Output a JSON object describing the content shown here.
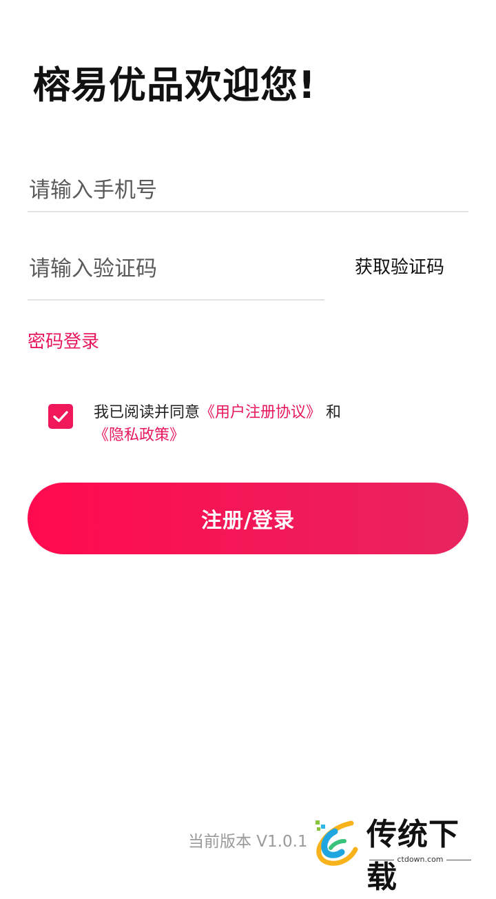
{
  "header": {
    "title": "榕易优品欢迎您!"
  },
  "form": {
    "phone_placeholder": "请输入手机号",
    "code_placeholder": "请输入验证码",
    "get_code_label": "获取验证码",
    "password_login_label": "密码登录"
  },
  "agreement": {
    "checked": true,
    "prefix": "我已阅读并同意",
    "user_agreement_link": "《用户注册协议》",
    "conjunction": " 和",
    "privacy_link": "《隐私政策》"
  },
  "submit": {
    "label": "注册/登录"
  },
  "footer": {
    "version": "当前版本 V1.0.1"
  },
  "watermark": {
    "text": "传统下载",
    "sub": "ctdown.com"
  },
  "colors": {
    "accent": "#f0175a",
    "link": "#e8175d",
    "muted": "#9a9a9a"
  }
}
